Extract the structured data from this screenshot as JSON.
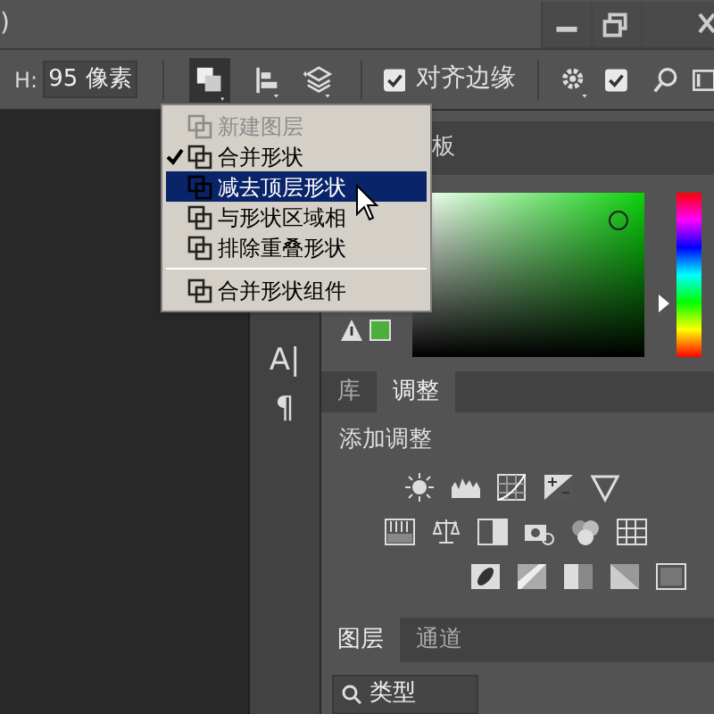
{
  "window": {
    "title_fragment": ")"
  },
  "options_bar": {
    "height_label": "H:",
    "height_value": "95 像素",
    "align_edges": {
      "label": "对齐边缘",
      "checked": true
    },
    "option_2": {
      "checked": true
    }
  },
  "shape_menu": {
    "items": [
      {
        "kind": "item",
        "label": "新建图层",
        "disabled": true,
        "checked": false,
        "selected": false
      },
      {
        "kind": "item",
        "label": "合并形状",
        "disabled": false,
        "checked": true,
        "selected": false
      },
      {
        "kind": "item",
        "label": "减去顶层形状",
        "disabled": false,
        "checked": false,
        "selected": true
      },
      {
        "kind": "item",
        "label": "与形状区域相",
        "disabled": false,
        "checked": false,
        "selected": false
      },
      {
        "kind": "item",
        "label": "排除重叠形状",
        "disabled": false,
        "checked": false,
        "selected": false
      },
      {
        "kind": "separator"
      },
      {
        "kind": "item",
        "label": "合并形状组件",
        "disabled": false,
        "checked": false,
        "selected": false
      }
    ]
  },
  "tools": [
    "A|",
    "¶"
  ],
  "color_panel": {
    "tab_fragment": "板",
    "hue_slider": {
      "level": 0.33
    }
  },
  "adjust_panel": {
    "tabs": [
      {
        "label": "库",
        "selected": false
      },
      {
        "label": "调整",
        "selected": true
      }
    ],
    "heading": "添加调整"
  },
  "layers_panel": {
    "tabs": [
      {
        "label": "图层",
        "selected": true
      },
      {
        "label": "通道",
        "selected": false
      }
    ],
    "filter": "类型"
  }
}
